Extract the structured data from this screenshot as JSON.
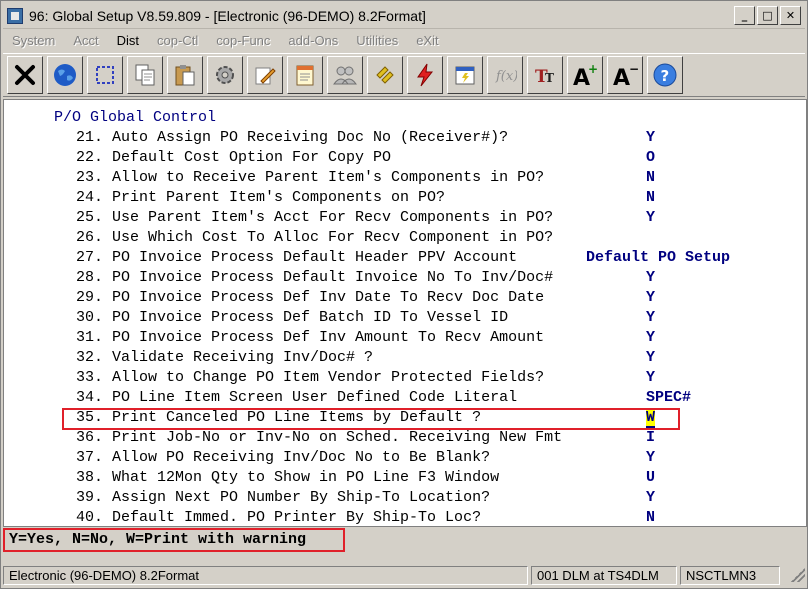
{
  "window": {
    "title": "96: Global Setup V8.59.809 - [Electronic (96-DEMO) 8.2Format]",
    "buttons": {
      "minimize": "_",
      "maximize": "□",
      "close": "✕"
    }
  },
  "menu": [
    {
      "label": "System",
      "enabled": false
    },
    {
      "label": "Acct",
      "enabled": false
    },
    {
      "label": "Dist",
      "enabled": true
    },
    {
      "label": "cop-Ctl",
      "enabled": false
    },
    {
      "label": "cop-Func",
      "enabled": false
    },
    {
      "label": "add-Ons",
      "enabled": false
    },
    {
      "label": "Utilities",
      "enabled": false
    },
    {
      "label": "eXit",
      "enabled": false
    }
  ],
  "toolbar": [
    {
      "name": "close-x-icon"
    },
    {
      "name": "globe-icon"
    },
    {
      "name": "select-box-icon"
    },
    {
      "name": "copy-icon"
    },
    {
      "name": "paste-icon"
    },
    {
      "name": "settings-gear-icon"
    },
    {
      "name": "edit-pencil-icon"
    },
    {
      "name": "notepad-icon"
    },
    {
      "name": "users-icon"
    },
    {
      "name": "link-chain-icon"
    },
    {
      "name": "lightning-icon"
    },
    {
      "name": "calendar-icon"
    },
    {
      "name": "function-fx-icon"
    },
    {
      "name": "font-tt-icon"
    },
    {
      "name": "font-increase-icon"
    },
    {
      "name": "font-decrease-icon"
    },
    {
      "name": "help-icon"
    }
  ],
  "form": {
    "section_title": "P/O Global Control",
    "rows": [
      {
        "num": "21.",
        "question": "Auto Assign PO Receiving Doc No (Receiver#)?",
        "value": "Y"
      },
      {
        "num": "22.",
        "question": "Default Cost Option For Copy PO",
        "value": "O"
      },
      {
        "num": "23.",
        "question": "Allow to Receive Parent Item's Components in PO?",
        "value": "N"
      },
      {
        "num": "24.",
        "question": "Print Parent Item's Components on PO?",
        "value": "N"
      },
      {
        "num": "25.",
        "question": "Use Parent Item's Acct For Recv Components in PO?",
        "value": "Y"
      },
      {
        "num": "26.",
        "question": "Use Which Cost To Alloc For Recv Component in PO?",
        "value": ""
      },
      {
        "num": "27.",
        "question": "PO Invoice Process Default Header PPV Account",
        "value": "",
        "extra": "Default PO Setup"
      },
      {
        "num": "28.",
        "question": "PO Invoice Process Default Invoice No To Inv/Doc#",
        "value": "Y"
      },
      {
        "num": "29.",
        "question": "PO Invoice Process Def Inv Date To Recv Doc Date",
        "value": "Y"
      },
      {
        "num": "30.",
        "question": "PO Invoice Process Def Batch ID To Vessel ID",
        "value": "Y"
      },
      {
        "num": "31.",
        "question": "PO Invoice Process Def Inv Amount To Recv Amount",
        "value": "Y"
      },
      {
        "num": "32.",
        "question": "Validate Receiving Inv/Doc# ?",
        "value": "Y"
      },
      {
        "num": "33.",
        "question": "Allow to Change PO Item Vendor Protected Fields?",
        "value": "Y"
      },
      {
        "num": "34.",
        "question": "PO Line Item Screen User Defined Code Literal",
        "value": "SPEC#"
      },
      {
        "num": "35.",
        "question": "Print Canceled PO Line Items by Default ?",
        "value": "W",
        "active": true
      },
      {
        "num": "36.",
        "question": "Print Job-No or Inv-No on Sched. Receiving New Fmt",
        "value": "I"
      },
      {
        "num": "37.",
        "question": "Allow PO Receiving Inv/Doc No to Be Blank?",
        "value": "Y"
      },
      {
        "num": "38.",
        "question": "What 12Mon Qty to Show in PO Line F3 Window",
        "value": "U"
      },
      {
        "num": "39.",
        "question": "Assign Next PO Number By Ship-To Location?",
        "value": "Y"
      },
      {
        "num": "40.",
        "question": "Default Immed. PO Printer By Ship-To Loc?",
        "value": "N"
      }
    ]
  },
  "hint": "Y=Yes, N=No, W=Print with warning",
  "status": {
    "company": "Electronic (96-DEMO) 8.2Format",
    "user": "001 DLM at TS4DLM",
    "terminal": "NSCTLMN3"
  },
  "colors": {
    "value_text": "#000080",
    "highlight_border": "#e0202a",
    "cursor_bg": "#ffff00"
  }
}
